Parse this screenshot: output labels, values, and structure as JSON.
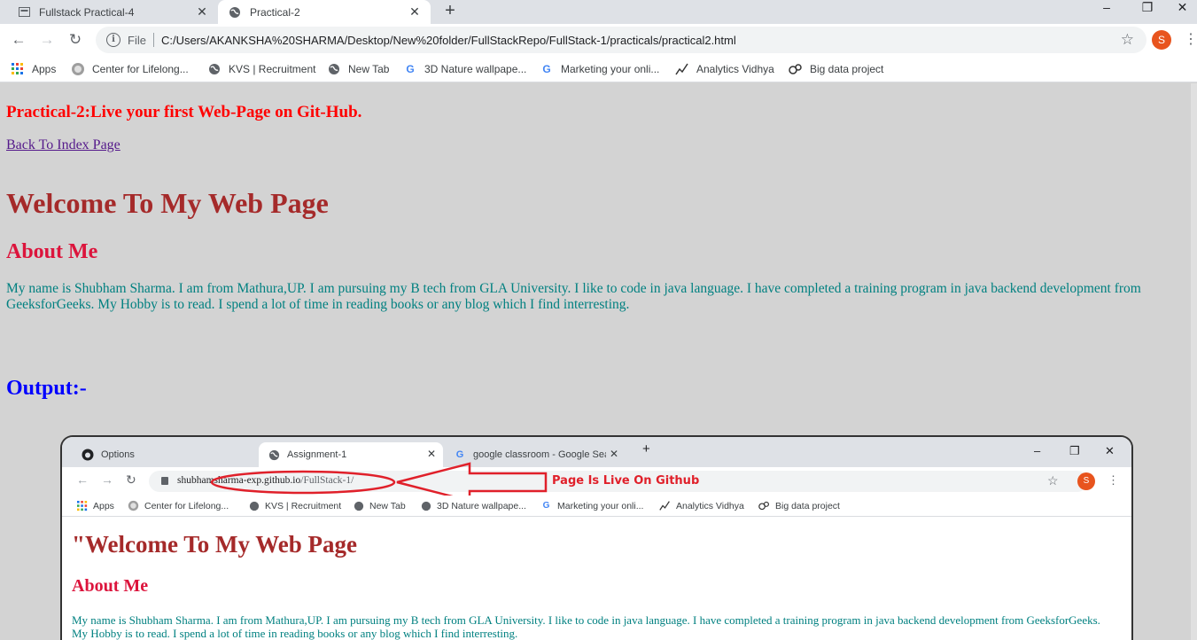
{
  "browser": {
    "tabs": [
      {
        "title": "Fullstack Practical-4",
        "icon": "document-icon",
        "active": false
      },
      {
        "title": "Practical-2",
        "icon": "globe-icon",
        "active": true
      }
    ],
    "new_tab": "+",
    "window_controls": {
      "minimize": "–",
      "restore": "❐",
      "close": "✕"
    },
    "nav": {
      "back": "←",
      "forward": "→",
      "reload": "↻"
    },
    "address": {
      "scheme": "File",
      "url": "C:/Users/AKANKSHA%20SHARMA/Desktop/New%20folder/FullStackRepo/FullStack-1/practicals/practical2.html"
    },
    "profile_initial": "S",
    "bookmarks": [
      {
        "label": "Apps",
        "icon": "apps-grid-icon"
      },
      {
        "label": "Center for Lifelong...",
        "icon": "seal-icon"
      },
      {
        "label": "KVS | Recruitment",
        "icon": "globe-icon"
      },
      {
        "label": "New Tab",
        "icon": "globe-icon"
      },
      {
        "label": "3D Nature wallpape...",
        "icon": "google-icon"
      },
      {
        "label": "Marketing your onli...",
        "icon": "google-icon"
      },
      {
        "label": "Analytics Vidhya",
        "icon": "analytics-icon"
      },
      {
        "label": "Big data project",
        "icon": "bigdata-icon"
      }
    ]
  },
  "page": {
    "practical_title": "Practical-2:Live your first Web-Page on Git-Hub.",
    "back_link": "Back To Index Page",
    "welcome": "Welcome To My Web Page",
    "about_heading": "About Me",
    "bio": "My name is Shubham Sharma. I am from Mathura,UP. I am pursuing my B tech from GLA University. I like to code in java language. I have completed a training program in java backend development from GeeksforGeeks. My Hobby is to read. I spend a lot of time in reading books or any blog which I find interresting.",
    "output_heading": "Output:-"
  },
  "screenshot": {
    "tabs": [
      {
        "title": "Options",
        "icon": "github-icon"
      },
      {
        "title": "Assignment-1",
        "icon": "globe-icon"
      },
      {
        "title": "google classroom - Google Sear",
        "icon": "google-icon"
      }
    ],
    "new_tab": "+",
    "window_controls": {
      "minimize": "–",
      "restore": "❐",
      "close": "✕"
    },
    "url_host": "shubhamsharma-exp.github.io",
    "url_path": "/FullStack-1/",
    "annotation": "Page Is Live On Github",
    "profile_initial": "S",
    "bookmarks": [
      {
        "label": "Apps"
      },
      {
        "label": "Center for Lifelong..."
      },
      {
        "label": "KVS | Recruitment"
      },
      {
        "label": "New Tab"
      },
      {
        "label": "3D Nature wallpape..."
      },
      {
        "label": "Marketing your onli..."
      },
      {
        "label": "Analytics Vidhya"
      },
      {
        "label": "Big data project"
      }
    ],
    "welcome": "\"Welcome To My Web Page",
    "about_heading": "About Me",
    "bio": "My name is Shubham Sharma. I am from Mathura,UP. I am pursuing my B tech from GLA University. I like to code in java language. I have completed a training program in java backend development from GeeksforGeeks. My Hobby is to read. I spend a lot of time in reading books or any blog which I find interresting."
  },
  "colors": {
    "practical_title": "#ff0000",
    "welcome": "#a52a2a",
    "about": "#dc143c",
    "bio": "#008080",
    "output": "#0000ff",
    "page_background": "#d3d3d3",
    "annotation": "#e0202a"
  }
}
